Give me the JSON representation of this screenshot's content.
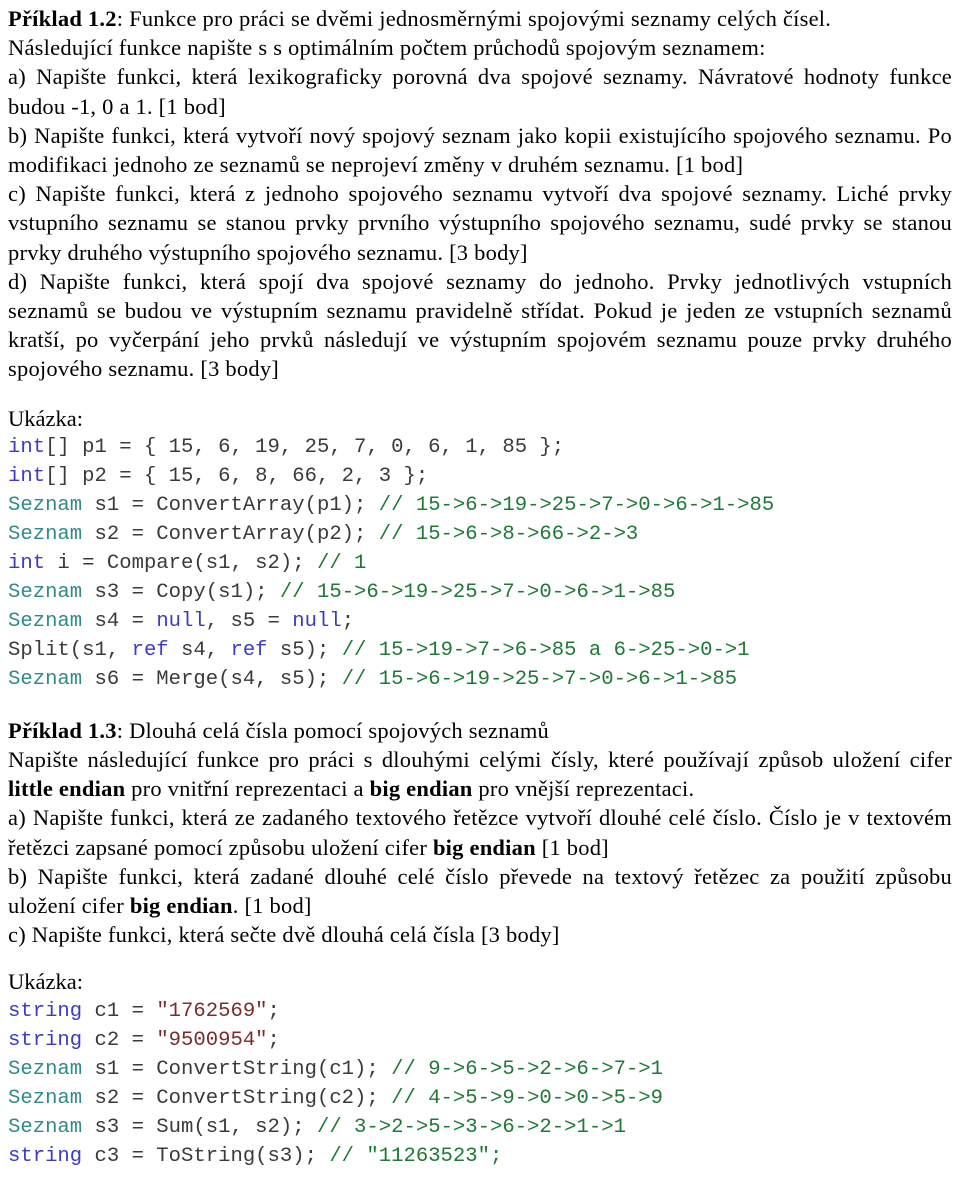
{
  "document": {
    "title_1": "Příklad 1.2",
    "title_1_rest": ": Funkce pro práci se dvěmi jednosměrnými spojovými seznamy celých čísel.",
    "intro_1": "Následující funkce napište s  s optimálním počtem průchodů spojovým seznamem:",
    "item_a_1": "a) Napište funkci, která lexikograficky porovná dva spojové seznamy. Návratové hodnoty funkce budou -1, 0 a 1. [1 bod]",
    "item_b_1": "b) Napište funkci, která vytvoří nový spojový seznam jako kopii existujícího spojového seznamu. Po modifikaci jednoho ze seznamů se neprojeví změny v druhém seznamu. [1 bod]",
    "item_c_1": "c) Napište funkci, která z jednoho spojového seznamu vytvoří dva spojové seznamy. Liché prvky vstupního seznamu se stanou prvky prvního výstupního spojového seznamu, sudé prvky se stanou prvky druhého výstupního spojového seznamu. [3 body]",
    "item_d_1": "d) Napište funkci, která spojí dva spojové seznamy do jednoho. Prvky jednotlivých vstupních seznamů se budou ve výstupním seznamu pravidelně střídat. Pokud je jeden ze vstupních seznamů kratší, po vyčerpání jeho prvků následují ve výstupním spojovém seznamu pouze prvky druhého spojového seznamu.  [3 body]",
    "ukazka_label_1": "Ukázka:",
    "title_2": "Příklad 1.3",
    "title_2_rest": ": Dlouhá celá čísla pomocí spojových seznamů",
    "intro_2_a": "Napište následující funkce pro práci s dlouhými celými čísly, které používají způsob uložení cifer ",
    "intro_2_bold_1": "little endian",
    "intro_2_b": " pro vnitřní reprezentaci a ",
    "intro_2_bold_2": "big endian",
    "intro_2_c": " pro vnější reprezentaci.",
    "item_a_2_a": "a) Napište funkci, která ze zadaného textového řetězce vytvoří dlouhé celé číslo. Číslo je v textovém řetězci zapsané pomocí způsobu uložení cifer ",
    "item_a_2_bold": "big endian",
    "item_a_2_b": "  [1 bod]",
    "item_b_2_a": "b) Napište funkci, která zadané dlouhé celé číslo převede na textový řetězec za použití způsobu uložení cifer ",
    "item_b_2_bold": "big endian",
    "item_b_2_b": ". [1 bod]",
    "item_c_2": "c) Napište funkci, která sečte dvě dlouhá celá čísla [3 body]",
    "ukazka_label_2": "Ukázka:"
  },
  "colors": {
    "keyword": "#3b3bc8",
    "type": "#2e8b89",
    "comment": "#1d7a34",
    "string": "#7c2b2b",
    "plain": "#3a3a3a",
    "background": "#ffffff",
    "text": "#000000"
  },
  "code_block_1": {
    "lines": [
      [
        {
          "t": "int",
          "c": "kw"
        },
        {
          "t": "[] p1 = { 15, 6, 19, 25, 7, 0, 6, 1, 85 };",
          "c": "pln"
        }
      ],
      [
        {
          "t": "int",
          "c": "kw"
        },
        {
          "t": "[] p2 = { 15, 6, 8, 66, 2, 3 };",
          "c": "pln"
        }
      ],
      [
        {
          "t": "Seznam",
          "c": "typ"
        },
        {
          "t": " s1 = ConvertArray(p1); ",
          "c": "pln"
        },
        {
          "t": "// 15->6->19->25->7->0->6->1->85",
          "c": "cmt"
        }
      ],
      [
        {
          "t": "Seznam",
          "c": "typ"
        },
        {
          "t": " s2 = ConvertArray(p2); ",
          "c": "pln"
        },
        {
          "t": "// 15->6->8->66->2->3",
          "c": "cmt"
        }
      ],
      [
        {
          "t": "int",
          "c": "kw"
        },
        {
          "t": " i = Compare(s1, s2); ",
          "c": "pln"
        },
        {
          "t": "// 1",
          "c": "cmt"
        }
      ],
      [
        {
          "t": "Seznam",
          "c": "typ"
        },
        {
          "t": " s3 = Copy(s1); ",
          "c": "pln"
        },
        {
          "t": "// 15->6->19->25->7->0->6->1->85",
          "c": "cmt"
        }
      ],
      [
        {
          "t": "Seznam",
          "c": "typ"
        },
        {
          "t": " s4 = ",
          "c": "pln"
        },
        {
          "t": "null",
          "c": "kw"
        },
        {
          "t": ", s5 = ",
          "c": "pln"
        },
        {
          "t": "null",
          "c": "kw"
        },
        {
          "t": ";",
          "c": "pln"
        }
      ],
      [
        {
          "t": "Split(s1, ",
          "c": "pln"
        },
        {
          "t": "ref",
          "c": "kw"
        },
        {
          "t": " s4, ",
          "c": "pln"
        },
        {
          "t": "ref",
          "c": "kw"
        },
        {
          "t": " s5); ",
          "c": "pln"
        },
        {
          "t": "// 15->19->7->6->85 a 6->25->0->1",
          "c": "cmt"
        }
      ],
      [
        {
          "t": "Seznam",
          "c": "typ"
        },
        {
          "t": " s6 = Merge(s4, s5); ",
          "c": "pln"
        },
        {
          "t": "// 15->6->19->25->7->0->6->1->85",
          "c": "cmt"
        }
      ]
    ]
  },
  "code_block_2": {
    "lines": [
      [
        {
          "t": "string",
          "c": "kw"
        },
        {
          "t": " c1 = ",
          "c": "pln"
        },
        {
          "t": "\"1762569\"",
          "c": "str"
        },
        {
          "t": ";",
          "c": "pln"
        }
      ],
      [
        {
          "t": "string",
          "c": "kw"
        },
        {
          "t": " c2 = ",
          "c": "pln"
        },
        {
          "t": "\"9500954\"",
          "c": "str"
        },
        {
          "t": ";",
          "c": "pln"
        }
      ],
      [
        {
          "t": "Seznam",
          "c": "typ"
        },
        {
          "t": " s1 = ConvertString(c1); ",
          "c": "pln"
        },
        {
          "t": "// 9->6->5->2->6->7->1",
          "c": "cmt"
        }
      ],
      [
        {
          "t": "Seznam",
          "c": "typ"
        },
        {
          "t": " s2 = ConvertString(c2); ",
          "c": "pln"
        },
        {
          "t": "// 4->5->9->0->0->5->9",
          "c": "cmt"
        }
      ],
      [
        {
          "t": "Seznam",
          "c": "typ"
        },
        {
          "t": " s3 = Sum(s1, s2); ",
          "c": "pln"
        },
        {
          "t": "// 3->2->5->3->6->2->1->1",
          "c": "cmt"
        }
      ],
      [
        {
          "t": "string",
          "c": "kw"
        },
        {
          "t": " c3 = ToString(s3); ",
          "c": "pln"
        },
        {
          "t": "// \"11263523\";",
          "c": "cmt"
        }
      ]
    ]
  }
}
